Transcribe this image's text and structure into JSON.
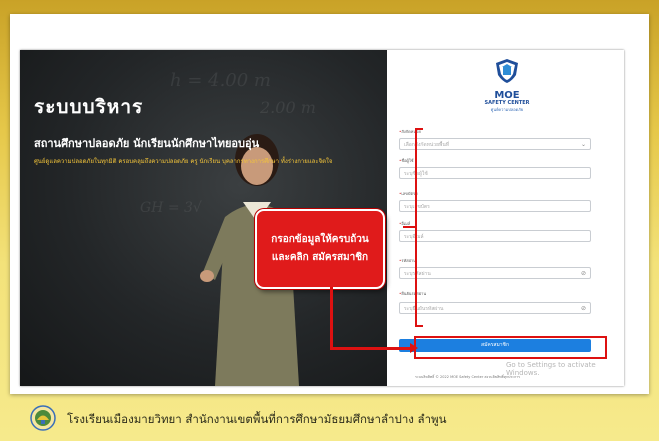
{
  "hero": {
    "title": "ระบบบริหาร",
    "subtitle": "สถานศึกษาปลอดภัย นักเรียนนักศึกษาไทยอบอุ่น",
    "description": "ศูนย์ดูแลความปลอดภัยในทุกมิติ ครอบคลุมถึงความปลอดภัย ครู นักเรียน บุคลากรทางการศึกษา ทั้งร่างกายและจิตใจ"
  },
  "callout": {
    "line1": "กรอกข้อมูลให้ครบถ้วน",
    "line2": "และคลิก สมัครสมาชิก"
  },
  "logo": {
    "name": "MOE",
    "sub": "SAFETY CENTER",
    "thai": "ศูนย์ความปลอดภัย"
  },
  "form": {
    "fields": [
      {
        "label": "สังกัดหน่วย",
        "placeholder": "เลือกสังกัดหน่วยพื้นที่",
        "trail": "⌄"
      },
      {
        "label": "ชื่อผู้ใช้",
        "placeholder": "ระบุชื่อผู้ใช้",
        "trail": ""
      },
      {
        "label": "เลขบัตรฯ",
        "placeholder": "ระบุเลขบัตร",
        "trail": ""
      },
      {
        "label": "อีเมล์",
        "placeholder": "ระบุอีเมล์",
        "trail": ""
      },
      {
        "label": "รหัสผ่าน",
        "placeholder": "ระบุรหัสผ่าน",
        "trail": "⊘"
      },
      {
        "label": "ยืนยันรหัสผ่าน",
        "placeholder": "ระบุยืนยันรหัสผ่าน",
        "trail": "⊘"
      }
    ],
    "submit_label": "สมัครสมาชิก"
  },
  "windows_watermark": "Go to Settings to activate Windows.",
  "copyright": "ระบบลิขสิทธิ์ © 2022 MOE Safety Center สงวนลิขสิทธิ์ทุกประการ",
  "footer": {
    "text": "โรงเรียนเมืองมายวิทยา  สำนักงานเขตพื้นที่การศึกษามัธยมศึกษาลำปาง  ลำพูน"
  },
  "colors": {
    "accent_red": "#e01b1b",
    "button_blue": "#1c7fe0",
    "brand_blue": "#1f4e9a",
    "hero_yellow": "#f3c43a"
  }
}
